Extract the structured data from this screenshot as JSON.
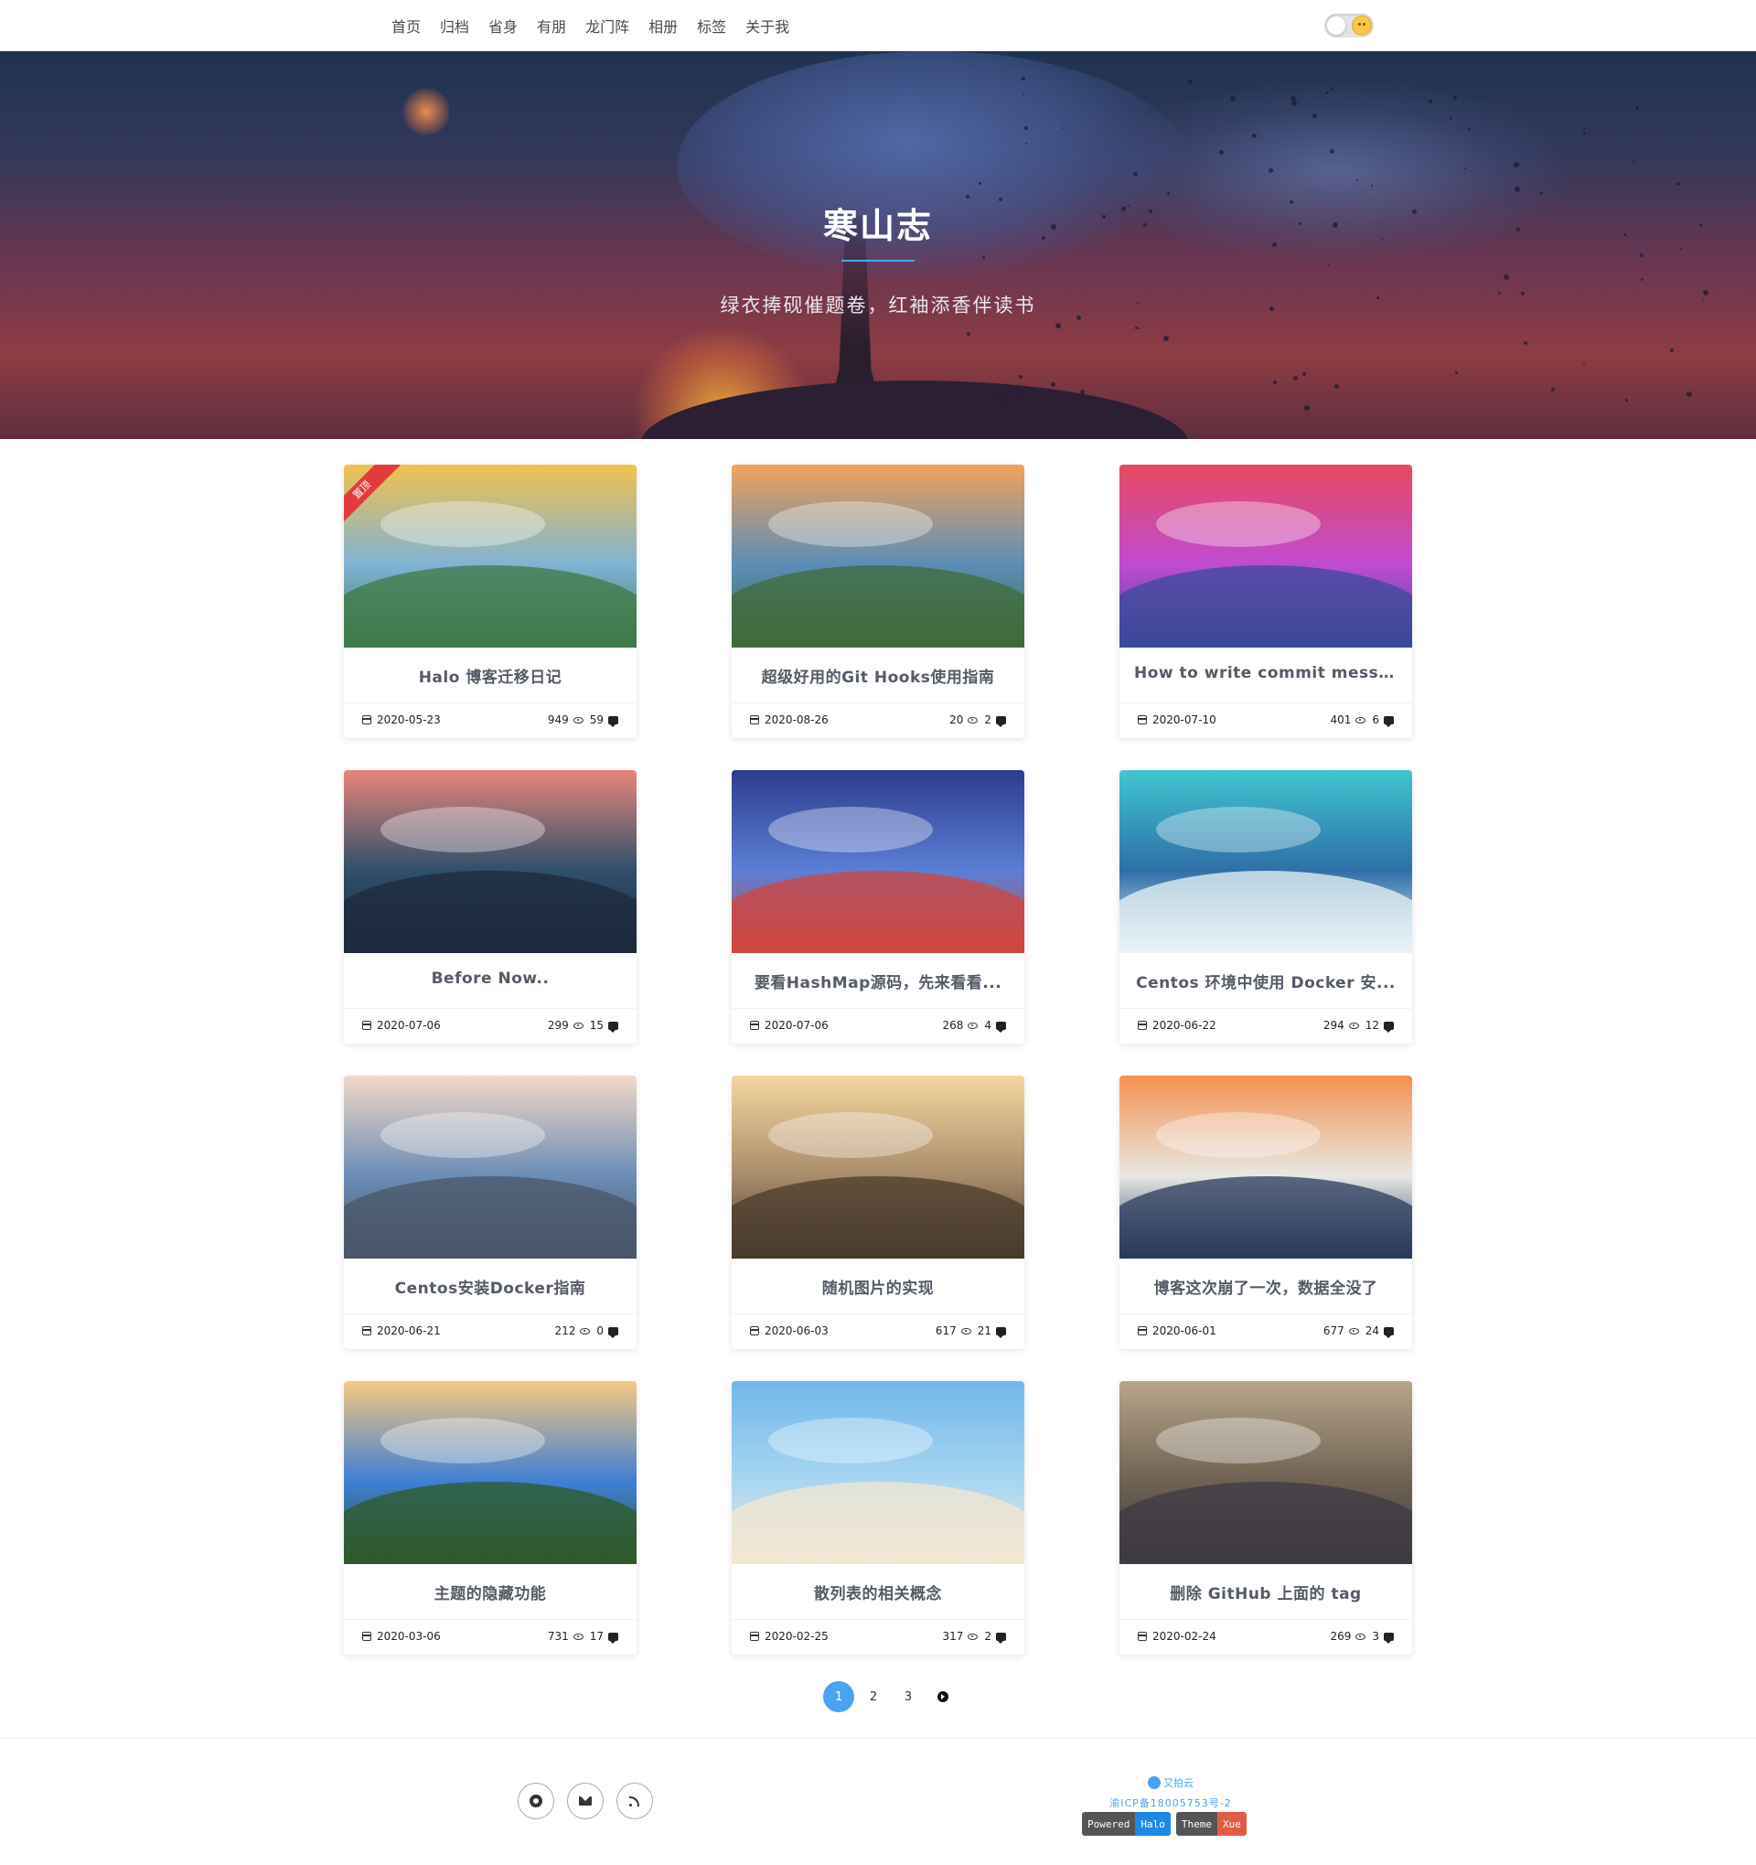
{
  "nav": {
    "items": [
      "首页",
      "归档",
      "省身",
      "有朋",
      "龙门阵",
      "相册",
      "标签",
      "关于我"
    ]
  },
  "hero": {
    "title": "寒山志",
    "subtitle": "绿衣捧砚催题卷，红袖添香伴读书"
  },
  "posts": [
    {
      "title": "Halo 博客迁移日记",
      "date": "2020-05-23",
      "views": "949",
      "comments": "59",
      "pinned": true,
      "pin_label": "置顶",
      "colors": [
        "#f2c14e",
        "#7fb3d5",
        "#3d7a46"
      ]
    },
    {
      "title": "超级好用的Git Hooks使用指南",
      "date": "2020-08-26",
      "views": "20",
      "comments": "2",
      "colors": [
        "#f0a35a",
        "#5b8db8",
        "#3f6b3a"
      ]
    },
    {
      "title": "How to write commit message...",
      "date": "2020-07-10",
      "views": "401",
      "comments": "6",
      "colors": [
        "#e84a5f",
        "#c04bd3",
        "#3a4a9a"
      ]
    },
    {
      "title": "Before Now..",
      "date": "2020-07-06",
      "views": "299",
      "comments": "15",
      "colors": [
        "#e8867a",
        "#2f4f6b",
        "#1e2a3c"
      ]
    },
    {
      "title": "要看HashMap源码，先来看看...",
      "date": "2020-07-06",
      "views": "268",
      "comments": "4",
      "colors": [
        "#2d3c8c",
        "#5b7fd6",
        "#d0453f"
      ]
    },
    {
      "title": "Centos 环境中使用 Docker 安...",
      "date": "2020-06-22",
      "views": "294",
      "comments": "12",
      "colors": [
        "#3fc6d0",
        "#2f6fa8",
        "#e8f3f6"
      ]
    },
    {
      "title": "Centos安装Docker指南",
      "date": "2020-06-21",
      "views": "212",
      "comments": "0",
      "colors": [
        "#f3d9c8",
        "#6b8db6",
        "#4a5568"
      ]
    },
    {
      "title": "随机图片的实现",
      "date": "2020-06-03",
      "views": "617",
      "comments": "21",
      "colors": [
        "#f6d7a0",
        "#a88c6a",
        "#4a3b2c"
      ]
    },
    {
      "title": "博客这次崩了一次，数据全没了",
      "date": "2020-06-01",
      "views": "677",
      "comments": "24",
      "colors": [
        "#f4914f",
        "#e8e8e4",
        "#283a5c"
      ]
    },
    {
      "title": "主题的隐藏功能",
      "date": "2020-03-06",
      "views": "731",
      "comments": "17",
      "colors": [
        "#f6c97f",
        "#3f7fd4",
        "#2e5a2a"
      ]
    },
    {
      "title": "散列表的相关概念",
      "date": "2020-02-25",
      "views": "317",
      "comments": "2",
      "colors": [
        "#6fb7ea",
        "#a8d6f2",
        "#f3e7d2"
      ]
    },
    {
      "title": "删除 GitHub 上面的 tag",
      "date": "2020-02-24",
      "views": "269",
      "comments": "3",
      "colors": [
        "#b7a58a",
        "#6f6253",
        "#3d3a44"
      ]
    }
  ],
  "pagination": {
    "pages": [
      "1",
      "2",
      "3"
    ],
    "current": "1"
  },
  "footer": {
    "upyun": "又拍云",
    "icp": "渝ICP备18005753号-2",
    "badges": [
      {
        "left": "Powered",
        "right": "Halo"
      },
      {
        "left": "Theme",
        "right": "Xue"
      }
    ]
  },
  "theme": {
    "accent": "#4aa3f0",
    "pin_red": "#e23b3b"
  }
}
